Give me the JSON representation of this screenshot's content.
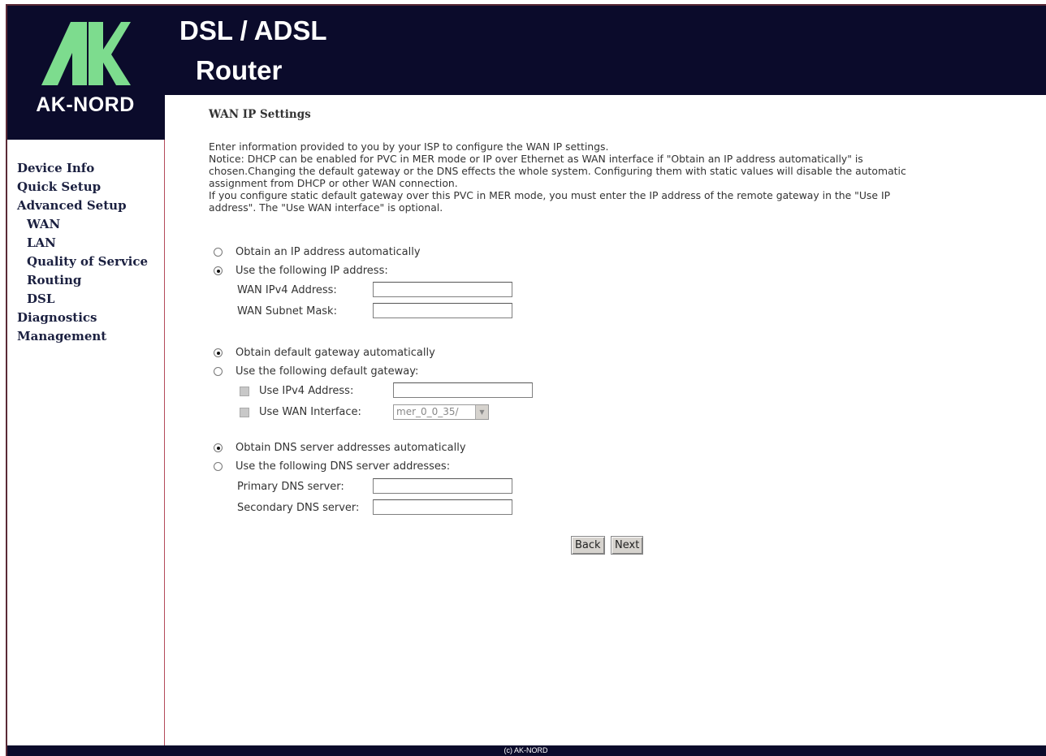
{
  "header": {
    "logo_text": "AK-NORD",
    "title_line1": "DSL / ADSL",
    "title_line2": "Router"
  },
  "sidebar": {
    "items": [
      {
        "label": "Device Info"
      },
      {
        "label": "Quick Setup"
      },
      {
        "label": "Advanced Setup"
      },
      {
        "label": "WAN"
      },
      {
        "label": "LAN"
      },
      {
        "label": "Quality of Service"
      },
      {
        "label": "Routing"
      },
      {
        "label": "DSL"
      },
      {
        "label": "Diagnostics"
      },
      {
        "label": "Management"
      }
    ]
  },
  "main": {
    "title": "WAN IP Settings",
    "description": [
      "Enter information provided to you by your ISP to configure the WAN IP settings.",
      "Notice: DHCP can be enabled for PVC in MER mode or IP over Ethernet as WAN interface if \"Obtain an IP address automatically\" is",
      "chosen.Changing the default gateway or the DNS effects the whole system. Configuring them with static values will disable the automatic",
      "assignment from DHCP or other WAN connection.",
      "If you configure static default gateway over this PVC in MER mode, you must enter the IP address of the remote gateway in the \"Use IP",
      "address\". The \"Use WAN interface\" is optional."
    ],
    "ip": {
      "auto_label": "Obtain an IP address automatically",
      "manual_label": "Use the following IP address:",
      "selected": "manual",
      "wan_ipv4_label": "WAN IPv4 Address:",
      "wan_ipv4_value": "",
      "subnet_label": "WAN Subnet Mask:",
      "subnet_value": ""
    },
    "gateway": {
      "auto_label": "Obtain default gateway automatically",
      "manual_label": "Use the following default gateway:",
      "selected": "auto",
      "use_ipv4_label": "Use IPv4 Address:",
      "use_ipv4_value": "",
      "use_ipv4_checked": false,
      "use_wan_label": "Use WAN Interface:",
      "use_wan_checked": false,
      "wan_interface_value": "mer_0_0_35/"
    },
    "dns": {
      "auto_label": "Obtain DNS server addresses automatically",
      "manual_label": "Use the following DNS server addresses:",
      "selected": "auto",
      "primary_label": "Primary DNS server:",
      "primary_value": "",
      "secondary_label": "Secondary DNS server:",
      "secondary_value": ""
    },
    "buttons": {
      "back": "Back",
      "next": "Next"
    }
  },
  "footer": {
    "copyright": "(c) AK-NORD"
  },
  "colors": {
    "header_bg": "#0b0b2b",
    "logo_green": "#7ddc8e",
    "nav_text": "#1b2040",
    "accent_border": "#b44a5a"
  },
  "icons": {
    "logo": "ak-nord-logo-icon",
    "select_arrow": "chevron-down-icon"
  }
}
